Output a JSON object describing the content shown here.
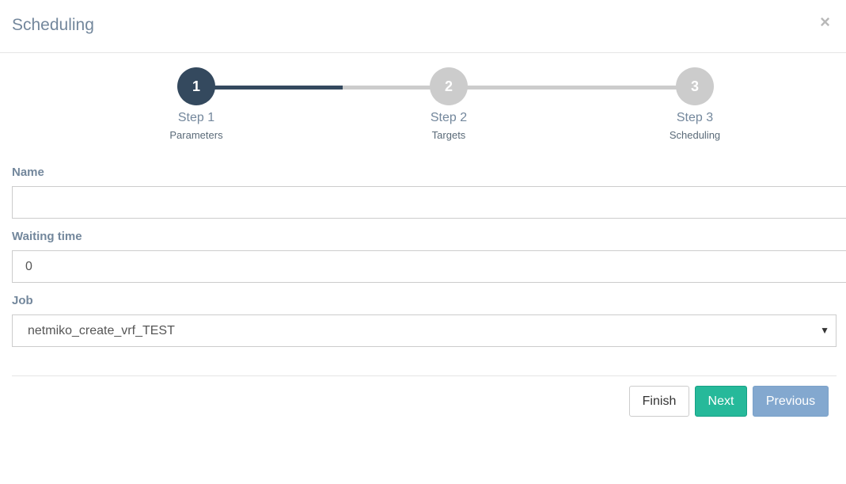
{
  "modal": {
    "title": "Scheduling",
    "close_symbol": "×"
  },
  "wizard": {
    "steps": [
      {
        "number": "1",
        "title": "Step 1",
        "description": "Parameters",
        "state": "done"
      },
      {
        "number": "2",
        "title": "Step 2",
        "description": "Targets",
        "state": "todo"
      },
      {
        "number": "3",
        "title": "Step 3",
        "description": "Scheduling",
        "state": "todo"
      }
    ]
  },
  "form": {
    "name": {
      "label": "Name",
      "value": ""
    },
    "waiting_time": {
      "label": "Waiting time",
      "value": "0"
    },
    "job": {
      "label": "Job",
      "selected": "netmiko_create_vrf_TEST"
    }
  },
  "buttons": {
    "finish": "Finish",
    "next": "Next",
    "previous": "Previous"
  },
  "colors": {
    "step_done": "#34495e",
    "step_todo": "#cccccc",
    "next_button": "#26b99a",
    "previous_button": "#83a8cf",
    "label": "#73879c"
  },
  "icons": {
    "close": "close-icon",
    "select_caret": "caret-down-icon"
  }
}
